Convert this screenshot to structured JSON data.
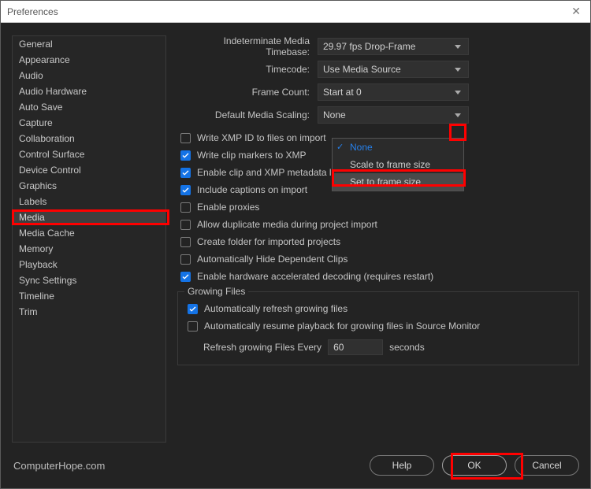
{
  "window": {
    "title": "Preferences"
  },
  "sidebar": {
    "items": [
      "General",
      "Appearance",
      "Audio",
      "Audio Hardware",
      "Auto Save",
      "Capture",
      "Collaboration",
      "Control Surface",
      "Device Control",
      "Graphics",
      "Labels",
      "Media",
      "Media Cache",
      "Memory",
      "Playback",
      "Sync Settings",
      "Timeline",
      "Trim"
    ],
    "selected_index": 11
  },
  "form": {
    "timebase_label": "Indeterminate Media Timebase:",
    "timebase_value": "29.97 fps Drop-Frame",
    "timecode_label": "Timecode:",
    "timecode_value": "Use Media Source",
    "framecount_label": "Frame Count:",
    "framecount_value": "Start at 0",
    "scaling_label": "Default Media Scaling:",
    "scaling_value": "None",
    "scaling_options": [
      "None",
      "Scale to frame size",
      "Set to frame size"
    ],
    "scaling_highlight_index": 2,
    "checks": [
      {
        "label": "Write XMP ID to files on import",
        "checked": false
      },
      {
        "label": "Write clip markers to XMP",
        "checked": true
      },
      {
        "label": "Enable clip and XMP metadata linking",
        "checked": true
      },
      {
        "label": "Include captions on import",
        "checked": true
      },
      {
        "label": "Enable proxies",
        "checked": false
      },
      {
        "label": "Allow duplicate media during project import",
        "checked": false
      },
      {
        "label": "Create folder for imported projects",
        "checked": false
      },
      {
        "label": "Automatically Hide Dependent Clips",
        "checked": false
      },
      {
        "label": "Enable hardware accelerated decoding (requires restart)",
        "checked": true
      }
    ],
    "growing": {
      "title": "Growing Files",
      "auto_refresh": {
        "label": "Automatically refresh growing files",
        "checked": true
      },
      "auto_resume": {
        "label": "Automatically resume playback for growing files in Source Monitor",
        "checked": false
      },
      "refresh_prefix": "Refresh growing Files Every",
      "refresh_value": "60",
      "refresh_suffix": "seconds"
    }
  },
  "footer": {
    "watermark": "ComputerHope.com",
    "help": "Help",
    "ok": "OK",
    "cancel": "Cancel"
  }
}
